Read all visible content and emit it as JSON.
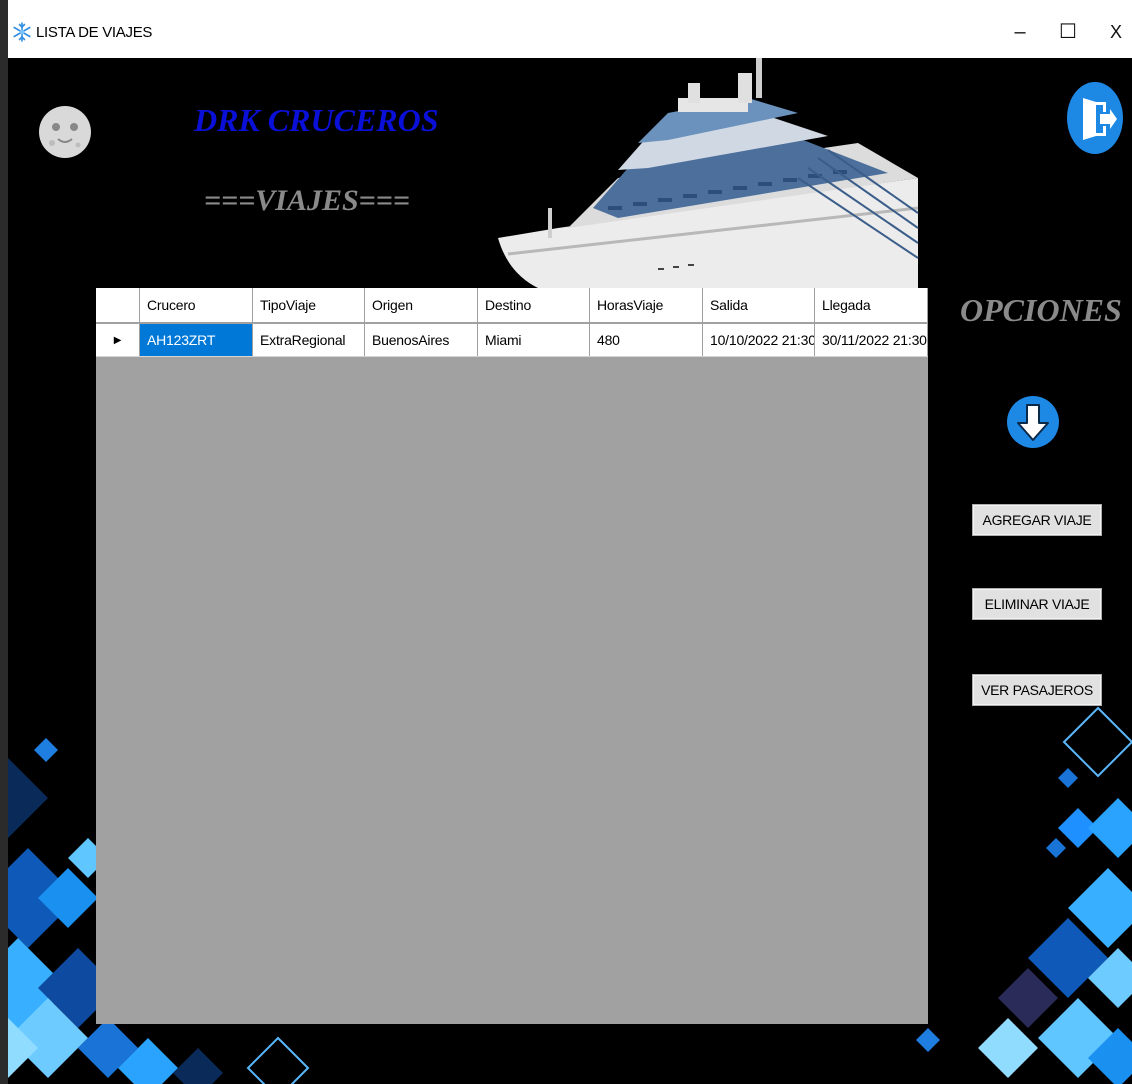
{
  "window": {
    "title": "LISTA DE VIAJES",
    "controls": {
      "minimize": "–",
      "maximize": "☐",
      "close": "X"
    }
  },
  "header": {
    "brand": "DRK CRUCEROS",
    "section": "===VIAJES==="
  },
  "table": {
    "columns": [
      "Crucero",
      "TipoViaje",
      "Origen",
      "Destino",
      "HorasViaje",
      "Salida",
      "Llegada"
    ],
    "rows": [
      {
        "indicator": "▶",
        "cells": [
          "AH123ZRT",
          "ExtraRegional",
          "BuenosAires",
          "Miami",
          "480",
          "10/10/2022 21:30",
          "30/11/2022 21:30"
        ]
      }
    ]
  },
  "options": {
    "title": "OPCIONES",
    "buttons": {
      "add": "AGREGAR VIAJE",
      "delete": "ELIMINAR VIAJE",
      "passengers": "VER PASAJEROS"
    }
  },
  "icons": {
    "app": "snowflake-icon",
    "moon": "moon-face-icon",
    "ship": "cruise-ship-image",
    "exit": "exit-door-icon",
    "down": "down-arrow-icon"
  },
  "colors": {
    "background": "#000000",
    "brand": "#0a10d8",
    "heading_gray": "#8a8a8a",
    "grid_empty": "#a1a1a1",
    "selection": "#0078d7",
    "icon_blue": "#1e88e5"
  }
}
